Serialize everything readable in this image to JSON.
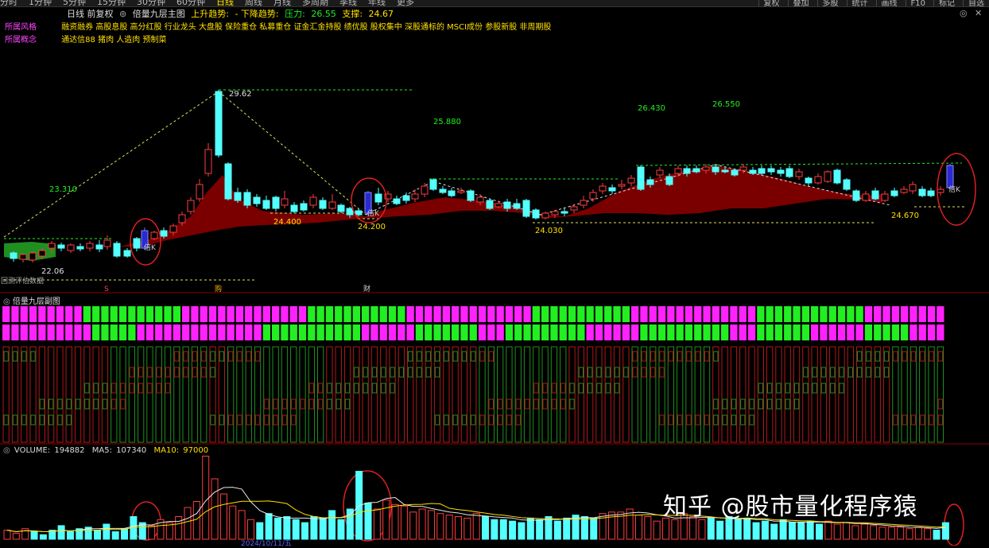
{
  "topbar": {
    "tabs": [
      "分时",
      "1分钟",
      "5分钟",
      "15分钟",
      "30分钟",
      "60分钟",
      "日线",
      "周线",
      "月线",
      "多周期",
      "季线",
      "年线",
      "更多"
    ],
    "active_tab": "日线",
    "buttons": [
      "复权",
      "叠加",
      "多股",
      "统计",
      "画线",
      "F10",
      "标记",
      "自选"
    ]
  },
  "info": {
    "period": "日线 前复权",
    "indicator": "倍量九层主图",
    "up_trend": "上升趋势:",
    "down_trend": "- 下降趋势:",
    "resistance_label": "压力:",
    "resistance_value": "26.55",
    "support_label": "支撑:",
    "support_value": "24.67"
  },
  "style_row": {
    "label": "所属风格",
    "value": "融资融券 高股息股 高分红股 行业龙头 大盘股 保险重仓 私募重仓 证金汇金持股 绩优股 股权集中 深股通标的 MSCI成份 参股新股 非周期股"
  },
  "concept_row": {
    "label": "所属概念",
    "value": "通达信88 猪肉 人造肉 预制菜"
  },
  "price_labels": {
    "high": "29.62",
    "low": "22.06",
    "p23310": "23.310",
    "p24400": "24.400",
    "p24200": "24.200",
    "p25880": "25.880",
    "p24030": "24.030",
    "p26430": "26.430",
    "p26550": "26.550",
    "p24670": "24.670",
    "bk": "倍K"
  },
  "markers": {
    "m1": "S",
    "m2": "购",
    "m3": "财"
  },
  "left_label": "回测评估数据",
  "sub_title": "倍量九层副图",
  "volume": {
    "label": "VOLUME:",
    "value": "194882",
    "ma5_label": "MA5:",
    "ma5_value": "107340",
    "ma10_label": "MA10:",
    "ma10_value": "97000"
  },
  "date_tag": "2024/10/11/五",
  "watermark": "知乎 @股市量化程序猿",
  "colors": {
    "up": "#ff3c3c",
    "down": "#54ffff",
    "magenta": "#ff22ff",
    "green": "#22ee22",
    "darkred": "#8b0000",
    "darkgreen": "#1f8f1f",
    "yellow": "#ffe000"
  }
}
